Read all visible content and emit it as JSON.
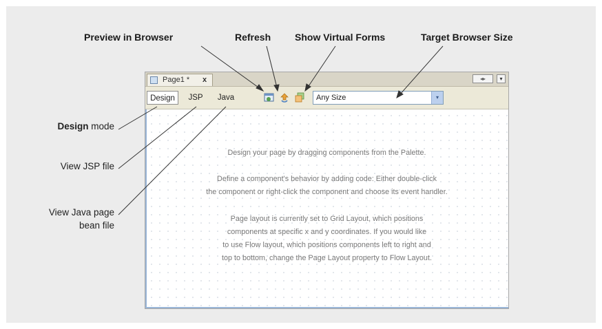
{
  "callouts": {
    "preview": "Preview  in Browser",
    "refresh": "Refresh",
    "virtual_forms": "Show Virtual Forms",
    "browser_size": "Target Browser Size"
  },
  "side_labels": {
    "design_bold": "Design",
    "design_rest": " mode",
    "jsp": "View JSP file",
    "java_line1": "View Java page",
    "java_line2": "bean  file"
  },
  "ide": {
    "tab_label": "Page1 *",
    "tab_close": "x",
    "nav_glyph": "◂▸",
    "menu_glyph": "▾",
    "views": {
      "design": "Design",
      "jsp": "JSP",
      "java": "Java"
    },
    "browser_size_value": "Any Size",
    "dropdown_glyph": "▾",
    "canvas_hints": [
      [
        "Design your page by dragging components from the Palette."
      ],
      [
        "Define a component's behavior by adding code: Either double-click",
        "the component or right-click the component and choose its event handler."
      ],
      [
        "Page layout is currently set to Grid Layout, which positions",
        "components at specific x and y coordinates.  If you would like",
        "to use Flow layout, which positions components left to right and",
        "top to bottom, change the Page Layout property to Flow Layout."
      ]
    ]
  },
  "colors": {
    "panel_bg": "#ececec",
    "toolbar_bg": "#ece9d8",
    "canvas_border": "#9ab6d8"
  }
}
